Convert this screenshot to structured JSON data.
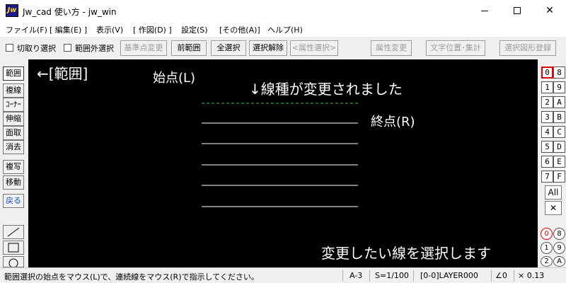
{
  "window": {
    "icon_text": "Jw",
    "title": "Jw_cad 使い方 - jw_win",
    "controls": {
      "close": "✕"
    }
  },
  "menu": {
    "items": [
      "ファイル(F)",
      "[ 編集(E) ]",
      "表示(V)",
      "[ 作図(D) ]",
      "設定(S)",
      "[その他(A)]",
      "ヘルプ(H)"
    ]
  },
  "toolbar": {
    "cut_select": "切取り選択",
    "outside_select": "範囲外選択",
    "base_point_change": "基準点変更",
    "prev_range": "前範囲",
    "select_all": "全選択",
    "cancel_select": "選択解除",
    "attr_select": "<属性選択>",
    "attr_change": "属性変更",
    "text_pos_total": "文字位置･集計",
    "register_shape": "選択図形登録"
  },
  "left_tools": {
    "range": "範囲",
    "multi_line": "複線",
    "corner": "ｺｰﾅｰ",
    "extend": "伸縮",
    "chamfer": "面取",
    "erase": "消去",
    "copy": "複写",
    "move": "移動",
    "undo": "戻る"
  },
  "canvas": {
    "range_label": "←[範囲]",
    "start_label": "始点(L)",
    "change_note": "↓線種が変更されました",
    "end_label": "終点(R)",
    "select_note": "変更したい線を選択します",
    "colors": {
      "background": "#000000",
      "line": "#ffffff",
      "changed_line": "#3ad13a"
    }
  },
  "layers": {
    "buttons": [
      "0",
      "8",
      "1",
      "9",
      "2",
      "A",
      "3",
      "B",
      "4",
      "C",
      "5",
      "D",
      "6",
      "E",
      "7",
      "F"
    ],
    "active": "0",
    "all": "All",
    "cross": "✕",
    "groups": [
      "0",
      "8",
      "1",
      "9",
      "2",
      "A"
    ],
    "active_group": "0"
  },
  "statusbar": {
    "message": "範囲選択の始点をマウス(L)で、連続線をマウス(R)で指示してください。",
    "paper": "A-3",
    "scale": "S=1/100",
    "layer": "[0-0]LAYER000",
    "angle": "∠0",
    "factor": "× 0.13"
  }
}
